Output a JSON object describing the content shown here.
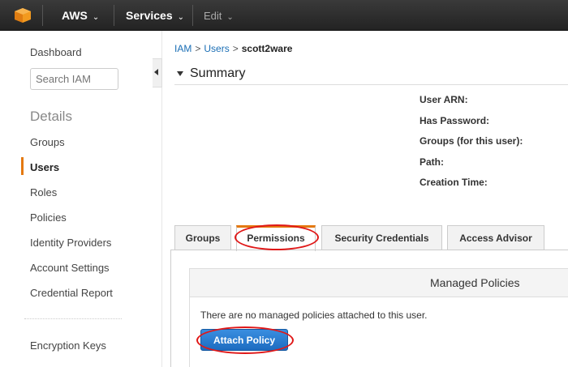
{
  "topbar": {
    "brand": "AWS",
    "services": "Services",
    "edit": "Edit",
    "caret": "⌄"
  },
  "sidebar": {
    "dashboard": "Dashboard",
    "search_placeholder": "Search IAM",
    "details_heading": "Details",
    "items": [
      {
        "label": "Groups"
      },
      {
        "label": "Users"
      },
      {
        "label": "Roles"
      },
      {
        "label": "Policies"
      },
      {
        "label": "Identity Providers"
      },
      {
        "label": "Account Settings"
      },
      {
        "label": "Credential Report"
      }
    ],
    "encryption_keys": "Encryption Keys"
  },
  "breadcrumb": {
    "root": "IAM",
    "section": "Users",
    "current": "scott2ware",
    "separator": ">"
  },
  "summary": {
    "title": "Summary",
    "fields": [
      "User ARN:",
      "Has Password:",
      "Groups (for this user):",
      "Path:",
      "Creation Time:"
    ]
  },
  "tabs": [
    {
      "label": "Groups"
    },
    {
      "label": "Permissions",
      "active": true
    },
    {
      "label": "Security Credentials"
    },
    {
      "label": "Access Advisor"
    }
  ],
  "managed_policies": {
    "heading": "Managed Policies",
    "empty_text": "There are no managed policies attached to this user.",
    "attach_button": "Attach Policy"
  },
  "colors": {
    "accent": "#e47911",
    "link": "#1a6eb5",
    "button": "#1d6cc0",
    "annotation": "#e01818"
  }
}
